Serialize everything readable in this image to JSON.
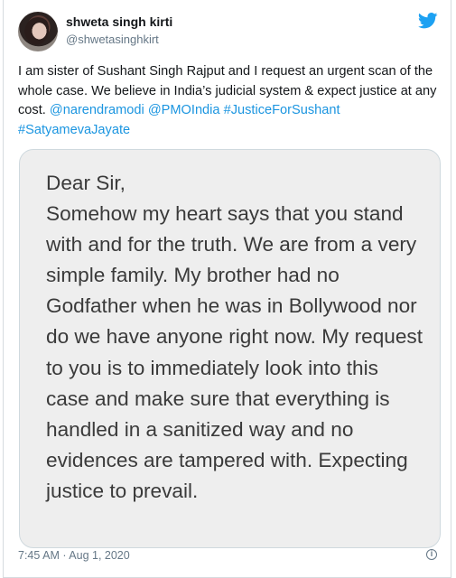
{
  "user": {
    "display_name": "shweta singh kirti",
    "handle": "@shwetasinghkirt"
  },
  "icons": {
    "brand": "twitter-bird-icon",
    "info": "info-icon",
    "brand_color": "#1da1f2"
  },
  "tweet": {
    "text_intro": "I am sister of Sushant Singh Rajput and I request an urgent scan of the whole case. We believe in India’s judicial system & expect justice at any cost.",
    "mention_1": "@narendramodi",
    "mention_2": "@PMOIndia",
    "hashtag_1": "#JusticeForSushant",
    "hashtag_2": "#SatyamevaJayate"
  },
  "note_image": {
    "text": "Dear Sir,\nSomehow my heart says that you stand with and for the truth. We are from a very simple family. My brother had no Godfather when he was in Bollywood nor do we have anyone right now. My request to you is to immediately look into this case and make sure that everything is handled in a sanitized way and no evidences are tampered with.  Expecting justice to prevail."
  },
  "footer": {
    "timestamp": "7:45 AM · Aug 1, 2020"
  }
}
